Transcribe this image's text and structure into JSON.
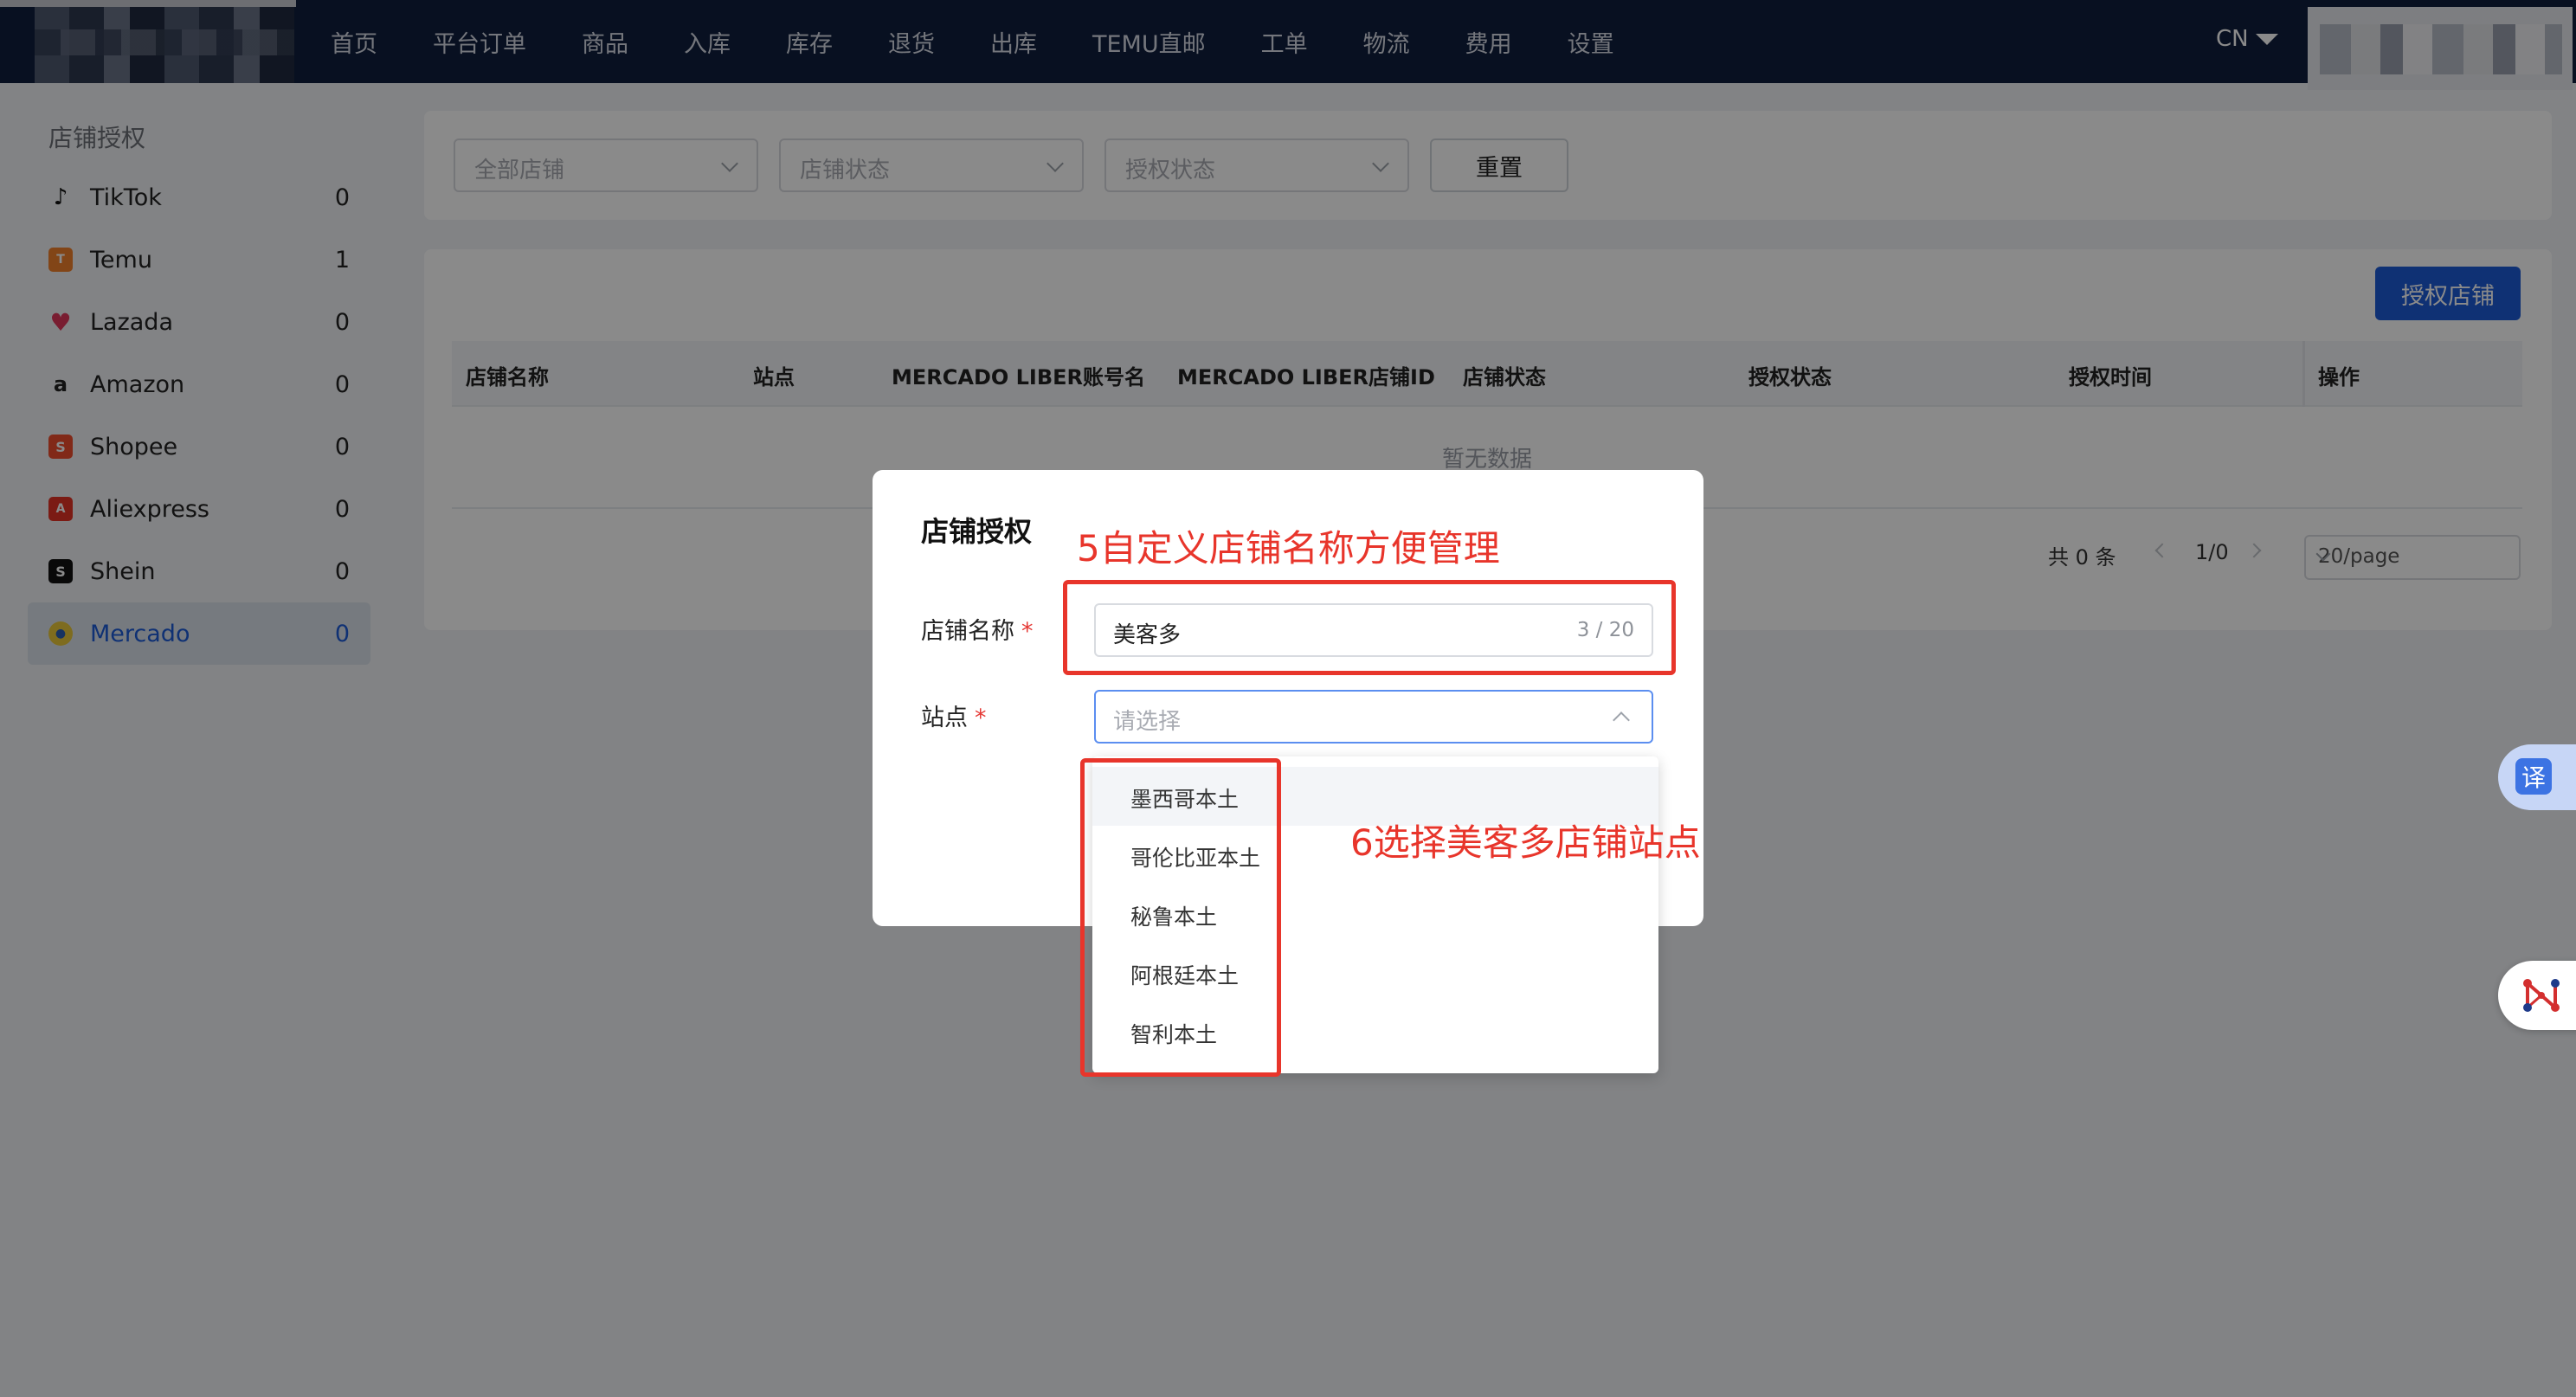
{
  "nav": {
    "items": [
      "首页",
      "平台订单",
      "商品",
      "入库",
      "库存",
      "退货",
      "出库",
      "TEMU直邮",
      "工单",
      "物流",
      "费用",
      "设置"
    ],
    "language": "CN"
  },
  "sidebar": {
    "title": "店铺授权",
    "items": [
      {
        "label": "TikTok",
        "count": "0",
        "icon": "tiktok-icon",
        "color": "#111111"
      },
      {
        "label": "Temu",
        "count": "1",
        "icon": "temu-icon",
        "color": "#f0802c"
      },
      {
        "label": "Lazada",
        "count": "0",
        "icon": "lazada-icon",
        "color": "#e0365c"
      },
      {
        "label": "Amazon",
        "count": "0",
        "icon": "amazon-icon",
        "color": "#222222"
      },
      {
        "label": "Shopee",
        "count": "0",
        "icon": "shopee-icon",
        "color": "#ee4d2d"
      },
      {
        "label": "Aliexpress",
        "count": "0",
        "icon": "aliexpress-icon",
        "color": "#e43225"
      },
      {
        "label": "Shein",
        "count": "0",
        "icon": "shein-icon",
        "color": "#111111"
      },
      {
        "label": "Mercado",
        "count": "0",
        "icon": "mercado-icon",
        "color": "#e9c83a",
        "active": true
      }
    ]
  },
  "filters": {
    "all_shops": "全部店铺",
    "shop_status": "店铺状态",
    "auth_status": "授权状态",
    "reset": "重置"
  },
  "table": {
    "auth_button": "授权店铺",
    "columns": [
      "店铺名称",
      "站点",
      "MERCADO LIBER账号名",
      "MERCADO LIBER店铺ID",
      "店铺状态",
      "授权状态",
      "授权时间",
      "操作"
    ],
    "empty": "暂无数据"
  },
  "pagination": {
    "total": "共 0 条",
    "page": "1/0",
    "page_size": "20/page"
  },
  "modal": {
    "title": "店铺授权",
    "name_label": "店铺名称",
    "name_value": "美客多",
    "name_count": "3 / 20",
    "site_label": "站点",
    "site_placeholder": "请选择",
    "required_mark": "*"
  },
  "dropdown": {
    "options": [
      "墨西哥本土",
      "哥伦比亚本土",
      "秘鲁本土",
      "阿根廷本土",
      "智利本土"
    ]
  },
  "annotations": {
    "step5": "5自定义店铺名称方便管理",
    "step6": "6选择美客多店铺站点"
  },
  "widgets": {
    "translate": "译"
  },
  "colors": {
    "nav_bg": "#0f1f3d",
    "primary": "#1d5bd6",
    "annotation": "#e8352b"
  }
}
